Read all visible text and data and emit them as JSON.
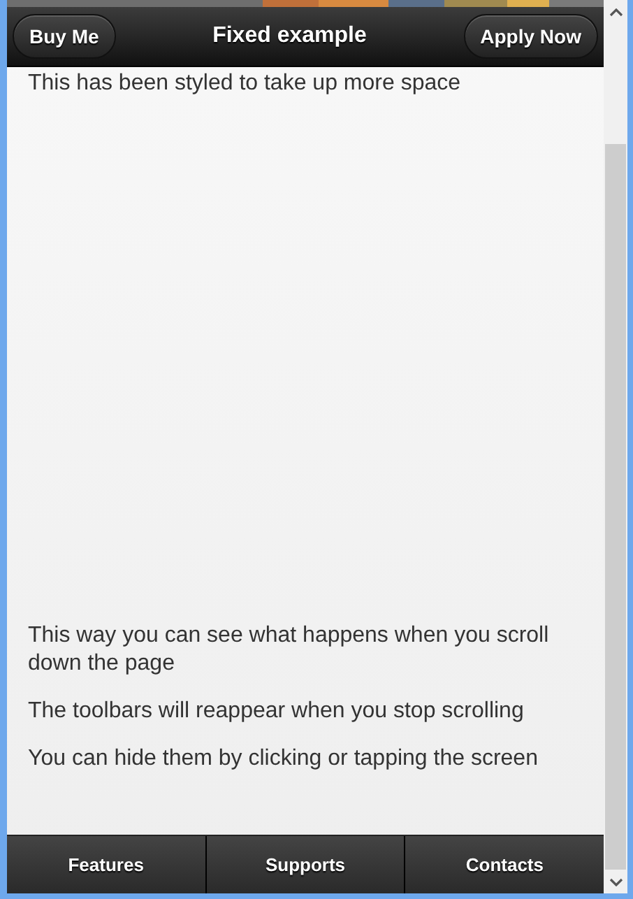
{
  "header": {
    "left_button": "Buy Me",
    "title": "Fixed example",
    "right_button": "Apply Now"
  },
  "content": {
    "paragraphs": [
      "This has been styled to take up more space",
      "This way you can see what happens when you scroll down the page",
      "The toolbars will reappear when you stop scrolling",
      "You can hide them by clicking or tapping the screen"
    ]
  },
  "footer": {
    "tabs": [
      "Features",
      "Supports",
      "Contacts"
    ]
  }
}
